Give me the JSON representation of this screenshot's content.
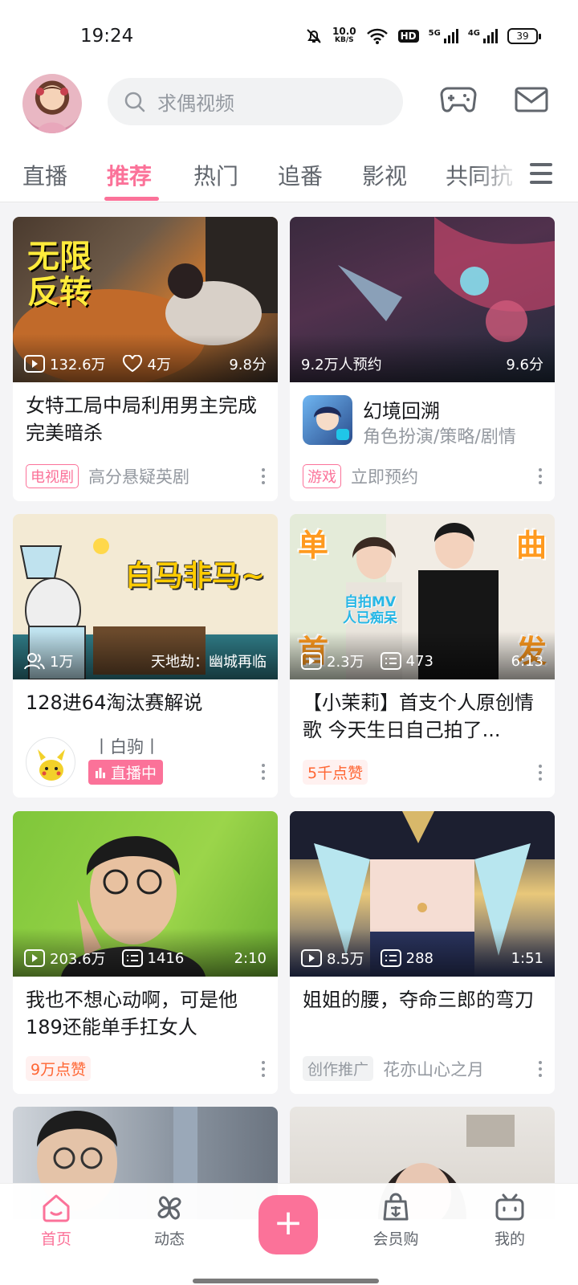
{
  "status": {
    "time": "19:24",
    "net_speed": "10.0",
    "net_unit": "KB/S",
    "hd": "HD",
    "sig1": "5G",
    "sig2": "4G",
    "battery": "39"
  },
  "search": {
    "placeholder": "求偶视频"
  },
  "tabs": [
    "直播",
    "推荐",
    "热门",
    "追番",
    "影视",
    "共同抗"
  ],
  "cards": [
    {
      "thumb_text": "无限\n反转",
      "plays": "132.6万",
      "likes": "4万",
      "score": "9.8分",
      "title": "女特工局中局利用男主完成完美暗杀",
      "tag": "电视剧",
      "meta": "高分悬疑英剧"
    },
    {
      "reserve": "9.2万人预约",
      "score": "9.6分",
      "game_name": "幻境回溯",
      "game_genre": "角色扮演/策略/剧情",
      "tag": "游戏",
      "meta": "立即预约"
    },
    {
      "thumb_text": "白马非马~",
      "viewers": "1万",
      "caption": "天地劫：幽城再临",
      "title": "128进64淘汰赛解说",
      "uploader": "丨白驹丨",
      "live": "直播中"
    },
    {
      "corner1": "单",
      "corner2": "曲",
      "corner3": "首",
      "corner4": "发",
      "sticker": "自拍MV\n人已痴呆",
      "plays": "2.3万",
      "danmaku": "473",
      "duration": "6:13",
      "title": "【小茉莉】首支个人原创情歌 今天生日自己拍了...",
      "tag": "5千点赞"
    },
    {
      "plays": "203.6万",
      "danmaku": "1416",
      "duration": "2:10",
      "title": "我也不想心动啊，可是他189还能单手扛女人",
      "tag": "9万点赞"
    },
    {
      "plays": "8.5万",
      "danmaku": "288",
      "duration": "1:51",
      "title": "姐姐的腰，夺命三郎的弯刀",
      "tag": "创作推广",
      "meta": "花亦山心之月"
    }
  ],
  "nav": {
    "home": "首页",
    "dynamic": "动态",
    "vip": "会员购",
    "mine": "我的",
    "plus": "+"
  },
  "colors": {
    "accent": "#fb7299",
    "bg": "#f4f4f6"
  }
}
